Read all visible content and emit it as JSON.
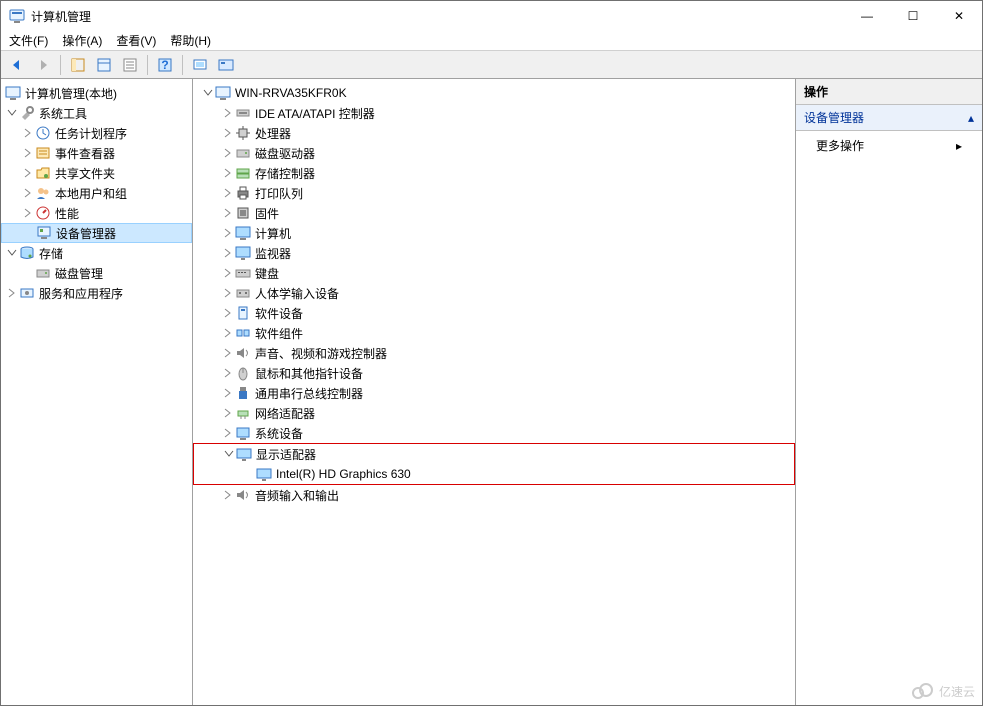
{
  "window": {
    "title": "计算机管理"
  },
  "menubar": {
    "file": "文件(F)",
    "action": "操作(A)",
    "view": "查看(V)",
    "help": "帮助(H)"
  },
  "winbtn": {
    "min": "—",
    "max": "☐",
    "close": "✕"
  },
  "left": {
    "root": "计算机管理(本地)",
    "systools": "系统工具",
    "taskscheduler": "任务计划程序",
    "eventviewer": "事件查看器",
    "sharedfolders": "共享文件夹",
    "localusers": "本地用户和组",
    "performance": "性能",
    "devicemgr": "设备管理器",
    "storage": "存储",
    "diskmgmt": "磁盘管理",
    "services": "服务和应用程序"
  },
  "center": {
    "root": "WIN-RRVA35KFR0K",
    "ide": "IDE ATA/ATAPI 控制器",
    "cpu": "处理器",
    "diskdrive": "磁盘驱动器",
    "storagectl": "存储控制器",
    "printq": "打印队列",
    "firmware": "固件",
    "computer": "计算机",
    "monitor": "监视器",
    "keyboard": "键盘",
    "hid": "人体学输入设备",
    "swdev": "软件设备",
    "swcomp": "软件组件",
    "sound": "声音、视频和游戏控制器",
    "mouse": "鼠标和其他指针设备",
    "usb": "通用串行总线控制器",
    "network": "网络适配器",
    "sysdev": "系统设备",
    "display": "显示适配器",
    "intelhd": "Intel(R) HD Graphics 630",
    "audio": "音频输入和输出"
  },
  "right": {
    "title": "操作",
    "section": "设备管理器",
    "more": "更多操作"
  },
  "watermark": "亿速云"
}
